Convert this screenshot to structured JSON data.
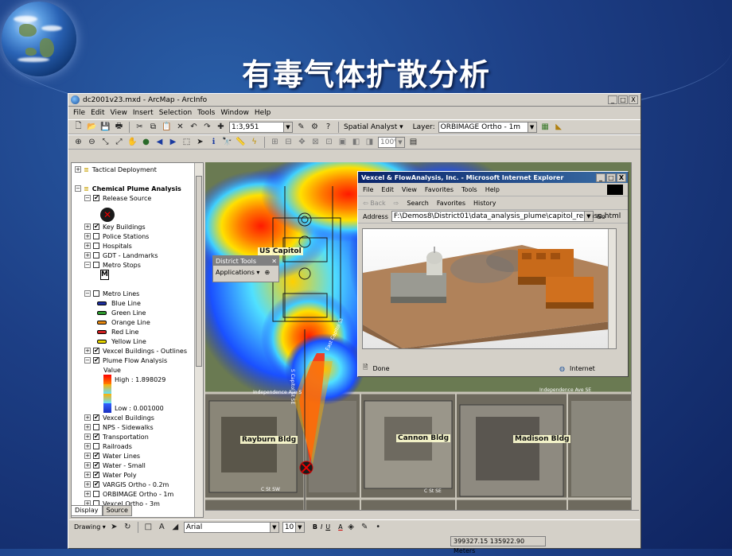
{
  "slide": {
    "title": "有毒气体扩散分析"
  },
  "arcmap": {
    "window_title": "dc2001v23.mxd - ArcMap - ArcInfo",
    "window_controls": [
      "_",
      "□",
      "X"
    ],
    "menu": [
      "File",
      "Edit",
      "View",
      "Insert",
      "Selection",
      "Tools",
      "Window",
      "Help"
    ],
    "toolbar": {
      "scale": "1:3,951",
      "spatial_analyst": "Spatial Analyst ▾",
      "layer_label": "Layer:",
      "layer_value": "ORBIMAGE Ortho - 1m",
      "zoom_value": "100%"
    },
    "toc": {
      "rows": [
        {
          "label": "Tactical Deployment",
          "level": 0,
          "expander": "+",
          "checked": null
        },
        {
          "label": "",
          "level": 0,
          "expander": null,
          "checked": null
        },
        {
          "label": "Chemical Plume Analysis",
          "level": 0,
          "expander": "−",
          "checked": null,
          "bold": true
        },
        {
          "label": "Release Source",
          "level": 1,
          "expander": "−",
          "checked": true
        },
        {
          "label": "",
          "level": 2,
          "expander": null,
          "checked": null,
          "symbol": "release-x"
        },
        {
          "label": "Key Buildings",
          "level": 1,
          "expander": "+",
          "checked": true
        },
        {
          "label": "Police Stations",
          "level": 1,
          "expander": "+",
          "checked": false
        },
        {
          "label": "Hospitals",
          "level": 1,
          "expander": "+",
          "checked": false
        },
        {
          "label": "GDT - Landmarks",
          "level": 1,
          "expander": "+",
          "checked": false
        },
        {
          "label": "Metro Stops",
          "level": 1,
          "expander": "−",
          "checked": false
        },
        {
          "label": "",
          "level": 2,
          "expander": null,
          "checked": null,
          "symbol": "metro-m"
        },
        {
          "label": "",
          "level": 2,
          "expander": null,
          "checked": null
        },
        {
          "label": "Metro Lines",
          "level": 1,
          "expander": "−",
          "checked": false
        },
        {
          "label": "Blue Line",
          "level": 2,
          "swatch": "#1d2fa0"
        },
        {
          "label": "Green Line",
          "level": 2,
          "swatch": "#2e9a2e"
        },
        {
          "label": "Orange Line",
          "level": 2,
          "swatch": "#e98a12"
        },
        {
          "label": "Red Line",
          "level": 2,
          "swatch": "#d02020"
        },
        {
          "label": "Yellow Line",
          "level": 2,
          "swatch": "#e8d500"
        },
        {
          "label": "Vexcel Buildings - Outlines",
          "level": 1,
          "expander": "+",
          "checked": true
        },
        {
          "label": "Plume Flow Analysis",
          "level": 1,
          "expander": "−",
          "checked": true
        },
        {
          "label": "Value",
          "level": 3
        },
        {
          "label": "High : 1.898029",
          "level": 3,
          "ramp": "top"
        },
        {
          "label": "",
          "level": 3,
          "ramp": "mid"
        },
        {
          "label": "",
          "level": 3,
          "ramp": "mid"
        },
        {
          "label": "Low : 0.001000",
          "level": 3,
          "ramp": "bottom"
        },
        {
          "label": "Vexcel Buildings",
          "level": 1,
          "expander": "+",
          "checked": true
        },
        {
          "label": "NPS - Sidewalks",
          "level": 1,
          "expander": "+",
          "checked": false
        },
        {
          "label": "Transportation",
          "level": 1,
          "expander": "+",
          "checked": true
        },
        {
          "label": "Railroads",
          "level": 1,
          "expander": "+",
          "checked": false
        },
        {
          "label": "Water Lines",
          "level": 1,
          "expander": "+",
          "checked": true
        },
        {
          "label": "Water - Small",
          "level": 1,
          "expander": "+",
          "checked": true
        },
        {
          "label": "Water Poly",
          "level": 1,
          "expander": "+",
          "checked": true
        },
        {
          "label": "VARGIS Ortho - 0.2m",
          "level": 1,
          "expander": "+",
          "checked": true
        },
        {
          "label": "ORBIMAGE Ortho - 1m",
          "level": 1,
          "expander": "+",
          "checked": false
        },
        {
          "label": "Vexcel Ortho - 3m",
          "level": 1,
          "expander": "+",
          "checked": false
        }
      ],
      "tabs": [
        "Display",
        "Source"
      ]
    },
    "district_tools": {
      "title": "District Tools",
      "applications": "Applications ▾"
    },
    "map_labels": {
      "capitol": "US Capitol",
      "rayburn": "Rayburn Bldg",
      "cannon": "Cannon Bldg",
      "madison": "Madison Bldg",
      "street_1": "Independence Ave S",
      "street_2": "Independence Ave SE",
      "street_3": "S Capitol St SE",
      "street_4": "East Capitol St",
      "street_5": "C St SW",
      "street_6": "C St SE"
    },
    "ie_window": {
      "title": "Vexcel & FlowAnalysis, Inc. - Microsoft Internet Explorer",
      "menu": [
        "File",
        "Edit",
        "View",
        "Favorites",
        "Tools",
        "Help"
      ],
      "nav": [
        "⇦ Back",
        "⇨",
        "Search",
        "Favorites",
        "History"
      ],
      "address_label": "Address",
      "address": "F:\\Demos8\\District01\\data_analysis_plume\\capitol_release.html",
      "go": "Go",
      "status_left": "Done",
      "status_right": "Internet"
    },
    "drawing_bar": {
      "drawing": "Drawing ▾",
      "font": "Arial",
      "size": "10",
      "bold": "B",
      "italic": "I",
      "underline": "U",
      "font_color": "A"
    },
    "status": {
      "coords": "399327.15  135922.90 Meters"
    }
  }
}
